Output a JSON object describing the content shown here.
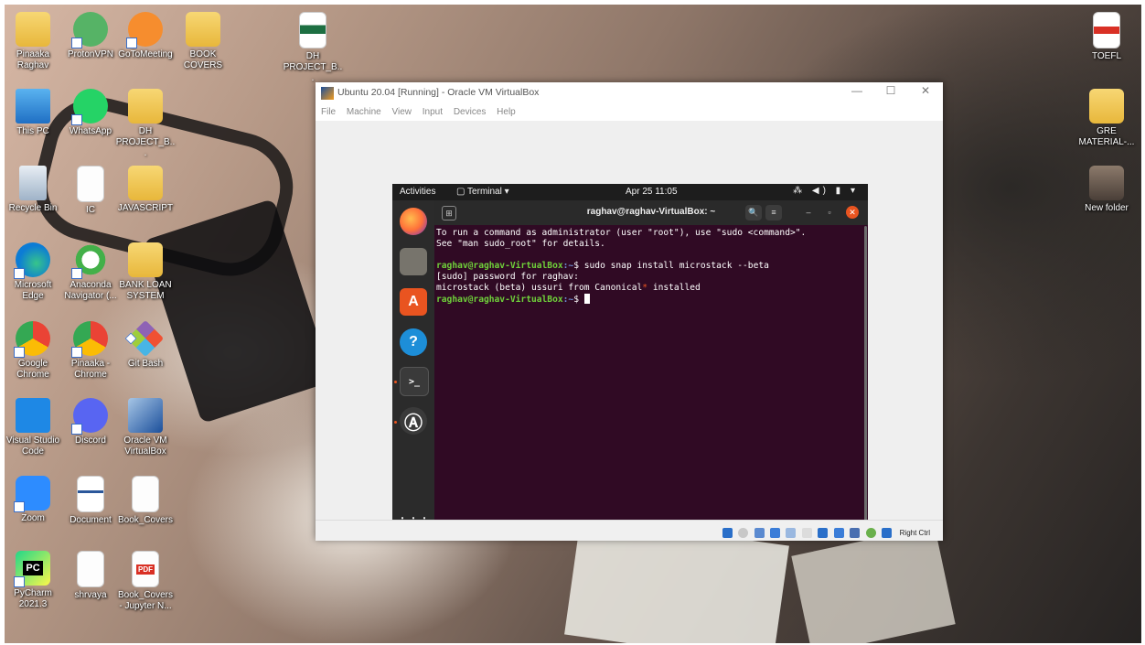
{
  "desktop": {
    "icons": [
      {
        "label": "Pinaaka Raghav"
      },
      {
        "label": "ProtonVPN"
      },
      {
        "label": "GoToMeeting"
      },
      {
        "label": "BOOK COVERS"
      },
      {
        "label": "DH PROJECT_B..."
      },
      {
        "label": "This PC"
      },
      {
        "label": "WhatsApp"
      },
      {
        "label": "DH PROJECT_B..."
      },
      {
        "label": "Recycle Bin"
      },
      {
        "label": "IC"
      },
      {
        "label": "JAVASCRIPT"
      },
      {
        "label": "Microsoft Edge"
      },
      {
        "label": "Anaconda Navigator (..."
      },
      {
        "label": "BANK LOAN SYSTEM"
      },
      {
        "label": "Google Chrome"
      },
      {
        "label": "Pinaaka - Chrome"
      },
      {
        "label": "Git Bash"
      },
      {
        "label": "Visual Studio Code"
      },
      {
        "label": "Discord"
      },
      {
        "label": "Oracle VM VirtualBox"
      },
      {
        "label": "Zoom"
      },
      {
        "label": "Document"
      },
      {
        "label": "Book_Covers"
      },
      {
        "label": "PyCharm 2021.3"
      },
      {
        "label": "shrvaya"
      },
      {
        "label": "Book_Covers - Jupyter N..."
      },
      {
        "label": "TOEFL"
      },
      {
        "label": "GRE MATERIAL-..."
      },
      {
        "label": "New folder"
      }
    ],
    "icon_glyphs": {
      "pc": "PC",
      "pdf": "PDF"
    }
  },
  "vbox": {
    "title": "Ubuntu 20.04 [Running] - Oracle VM VirtualBox",
    "window_controls": {
      "minimize": "—",
      "maximize": "☐",
      "close": "✕"
    },
    "menu": [
      "File",
      "Machine",
      "View",
      "Input",
      "Devices",
      "Help"
    ],
    "status": {
      "host_key": "Right Ctrl"
    }
  },
  "ubuntu": {
    "topbar": {
      "activities": "Activities",
      "app_menu": "▢ Terminal ▾",
      "clock": "Apr 25  11:05",
      "system": "⁂ ◀) ▮ ▾"
    },
    "dock": {
      "help_glyph": "?",
      "terminal_glyph": ">_",
      "software_glyph": "A",
      "software_updater_glyph": "Ⓐ",
      "apps_grid_glyph": "⋮⋮⋮"
    },
    "terminal": {
      "title": "raghav@raghav-VirtualBox: ~",
      "tab_icon": "⊞",
      "search": "🔍",
      "menu": "≡",
      "minimize": "–",
      "maximize": "▫",
      "close": "✕",
      "lines": {
        "l1": "To run a command as administrator (user \"root\"), use \"sudo <command>\".",
        "l2": "See \"man sudo_root\" for details.",
        "prompt_user": "raghav@raghav-VirtualBox",
        "prompt_path": ":~",
        "prompt_sym": "$ ",
        "cmd1": "sudo snap install microstack --beta",
        "l4": "[sudo] password for raghav:",
        "l5a": "microstack (beta) ussuri from Canonical",
        "l5star": "*",
        "l5b": " installed"
      }
    }
  }
}
